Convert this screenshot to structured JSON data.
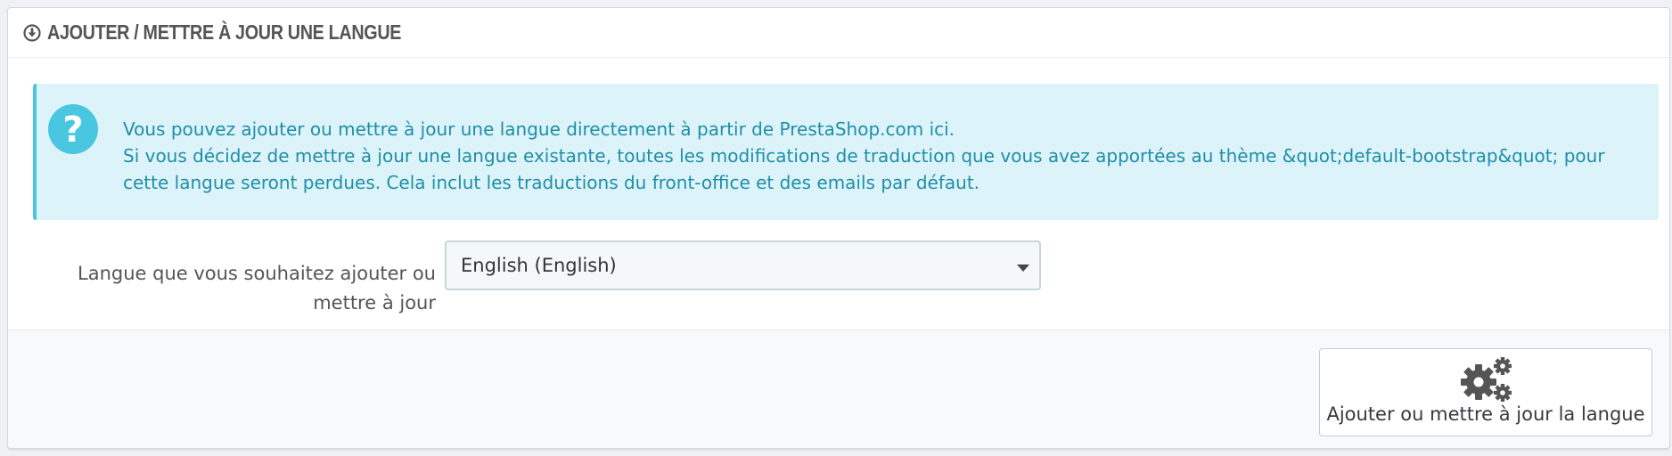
{
  "panel": {
    "title": "AJOUTER / METTRE À JOUR UNE LANGUE",
    "title_icon": "download-circle-icon"
  },
  "alert": {
    "icon": "question-circle-icon",
    "lines": [
      "Vous pouvez ajouter ou mettre à jour une langue directement à partir de PrestaShop.com ici.",
      "Si vous décidez de mettre à jour une langue existante, toutes les modifications de traduction que vous avez apportées au thème &quot;default-bootstrap&quot; pour",
      "cette langue seront perdues. Cela inclut les traductions du front-office et des emails par défaut."
    ]
  },
  "form": {
    "label_lines": [
      "Langue que vous souhaitez ajouter ou",
      "mettre à jour"
    ],
    "language_select": {
      "selected": "English (English)"
    }
  },
  "footer": {
    "submit_label": "Ajouter ou mettre à jour la langue",
    "submit_icon": "gears-icon"
  },
  "colors": {
    "alert_background": "#dcf4f9",
    "alert_border": "#4ac7e0",
    "alert_text": "#1f8ea8",
    "heading_text": "#555555"
  }
}
